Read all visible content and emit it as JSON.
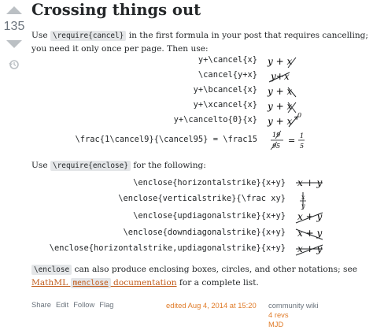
{
  "vote": {
    "score": "135"
  },
  "answer": {
    "title": "Crossing things out",
    "p1_a": "Use",
    "p1_code": "\\require{cancel}",
    "p1_b": "in the first formula in your post that requires cancelling; you need it only once per page. Then use:",
    "cancel_rows": [
      {
        "src": "y+\\cancel{x}"
      },
      {
        "src": "\\cancel{y+x}"
      },
      {
        "src": "y+\\bcancel{x}"
      },
      {
        "src": "y+\\xcancel{x}"
      },
      {
        "src": "y+\\cancelto{0}{x}"
      },
      {
        "src": "\\frac{1\\cancel9}{\\cancel95} = \\frac15"
      }
    ],
    "p2_a": "Use",
    "p2_code": "\\require{enclose}",
    "p2_b": "for the following:",
    "enclose_rows": [
      {
        "src": "\\enclose{horizontalstrike}{x+y}"
      },
      {
        "src": "\\enclose{verticalstrike}{\\frac xy}"
      },
      {
        "src": "\\enclose{updiagonalstrike}{x+y}"
      },
      {
        "src": "\\enclose{downdiagonalstrike}{x+y}"
      },
      {
        "src": "\\enclose{horizontalstrike,updiagonalstrike}{x+y}"
      }
    ],
    "p3_code": "\\enclose",
    "p3_a": "can also produce enclosing boxes, circles, and other notations; see",
    "p3_link1": "MathML",
    "p3_link_code": "menclose",
    "p3_link2": "documentation",
    "p3_b": "for a complete list."
  },
  "post_menu": {
    "share": "Share",
    "edit": "Edit",
    "follow": "Follow",
    "flag": "Flag"
  },
  "edited": "edited Aug 4, 2014 at 15:20",
  "wiki": {
    "label": "community wiki",
    "revs": "4 revs",
    "user": "MJD"
  },
  "colors": {
    "link": "#c05b1a",
    "accent": "#e07b28",
    "code_bg": "#e4e6e8"
  }
}
